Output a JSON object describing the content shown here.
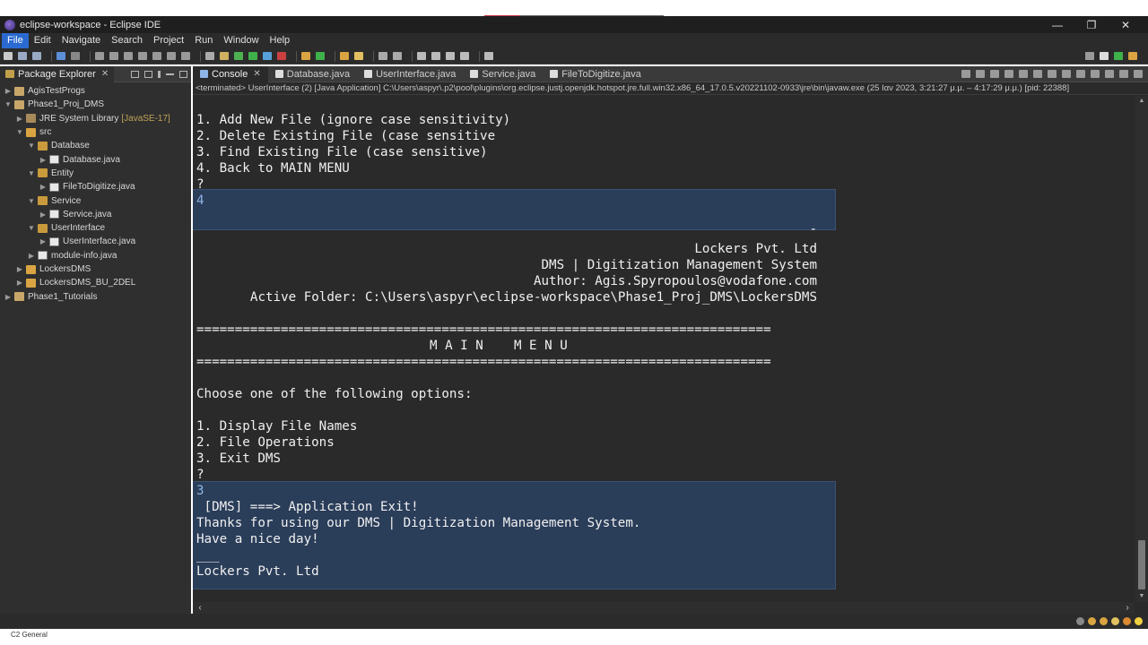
{
  "window": {
    "title": "eclipse-workspace - Eclipse IDE",
    "controls": [
      "minimize-icon",
      "maximize-icon",
      "close-icon"
    ]
  },
  "menu": {
    "items": [
      "File",
      "Edit",
      "Navigate",
      "Search",
      "Project",
      "Run",
      "Window",
      "Help"
    ]
  },
  "explorer": {
    "tab_label": "Package Explorer",
    "tree": [
      {
        "label": "AgisTestProgs",
        "type": "project",
        "expanded": false
      },
      {
        "label": "Phase1_Proj_DMS",
        "type": "project",
        "expanded": true
      },
      {
        "label": "JRE System Library",
        "tag": "[JavaSE-17]",
        "type": "lib",
        "expanded": false
      },
      {
        "label": "src",
        "type": "folder",
        "expanded": true
      },
      {
        "label": "Database",
        "type": "pkg",
        "expanded": true
      },
      {
        "label": "Database.java",
        "type": "java",
        "expanded": false
      },
      {
        "label": "Entity",
        "type": "pkg",
        "expanded": true
      },
      {
        "label": "FileToDigitize.java",
        "type": "java",
        "expanded": false
      },
      {
        "label": "Service",
        "type": "pkg",
        "expanded": true
      },
      {
        "label": "Service.java",
        "type": "java",
        "expanded": false
      },
      {
        "label": "UserInterface",
        "type": "pkg",
        "expanded": true
      },
      {
        "label": "UserInterface.java",
        "type": "java",
        "expanded": false
      },
      {
        "label": "module-info.java",
        "type": "java",
        "expanded": false
      },
      {
        "label": "LockersDMS",
        "type": "folder",
        "expanded": false
      },
      {
        "label": "LockersDMS_BU_2DEL",
        "type": "folder",
        "expanded": false
      },
      {
        "label": "Phase1_Tutorials",
        "type": "project",
        "expanded": false
      }
    ]
  },
  "editor": {
    "tabs": [
      "Console",
      "Database.java",
      "UserInterface.java",
      "Service.java",
      "FileToDigitize.java"
    ],
    "status": "<terminated> UserInterface (2) [Java Application] C:\\Users\\aspyr\\.p2\\pool\\plugins\\org.eclipse.justj.openjdk.hotspot.jre.full.win32.x86_64_17.0.5.v20221102-0933\\jre\\bin\\javaw.exe  (25 Ιαν 2023, 3:21:27 μ.μ. – 4:17:29 μ.μ.) [pid: 22388]"
  },
  "console": {
    "file_menu": [
      "1. Add New File (ignore case sensitivity)",
      "2. Delete Existing File (case sensitive",
      "3. Find Existing File (case sensitive)",
      "4. Back to MAIN MENU",
      "?"
    ],
    "input1": "4",
    "dash": "-",
    "header": [
      "Lockers Pvt. Ltd",
      "DMS | Digitization Management System",
      "Author: Agis.Spyropoulos@vodafone.com",
      "Active Folder: C:\\Users\\aspyr\\eclipse-workspace\\Phase1_Proj_DMS\\LockersDMS"
    ],
    "rule": "===========================================================================",
    "main_menu_title": "M A I N    M E N U",
    "prompt": "Choose one of the following options:",
    "main_menu": [
      "1. Display File Names",
      "2. File Operations",
      "3. Exit DMS",
      "?"
    ],
    "input2": "3",
    "exit_lines": [
      " [DMS] ===> Application Exit!",
      "Thanks for using our DMS | Digitization Management System.",
      "Have a nice day!",
      "___",
      "Lockers Pvt. Ltd"
    ]
  },
  "footer": "C2 General"
}
